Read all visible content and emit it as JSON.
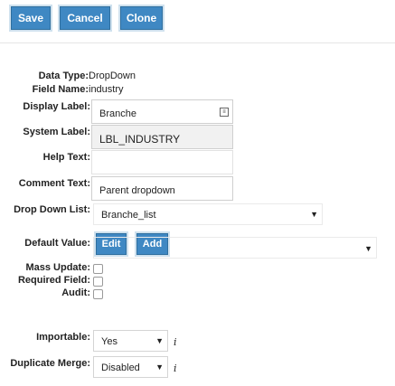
{
  "toolbar": {
    "save_label": "Save",
    "cancel_label": "Cancel",
    "clone_label": "Clone"
  },
  "form": {
    "data_type_label": "Data Type:",
    "data_type_value": "DropDown",
    "field_name_label": "Field Name:",
    "field_name_value": "industry",
    "display_label_label": "Display Label:",
    "display_label_value": "Branche",
    "system_label_label": "System Label:",
    "system_label_value": "LBL_INDUSTRY",
    "help_text_label": "Help Text:",
    "help_text_value": "",
    "comment_text_label": "Comment Text:",
    "comment_text_value": "Parent dropdown",
    "dropdown_list_label": "Drop Down List:",
    "dropdown_list_value": "Branche_list",
    "edit_label": "Edit",
    "add_label": "Add",
    "default_value_label": "Default Value:",
    "default_value_value": "",
    "mass_update_label": "Mass Update:",
    "required_field_label": "Required Field:",
    "audit_label": "Audit:",
    "importable_label": "Importable:",
    "importable_value": "Yes",
    "duplicate_merge_label": "Duplicate Merge:",
    "duplicate_merge_value": "Disabled"
  },
  "icons": {
    "translate": "translate-icon",
    "info": "info-icon",
    "dropdown": "chevron-down-icon"
  },
  "colors": {
    "button_blue": "#3f88c3",
    "readonly_field": "#f1f1f1"
  }
}
